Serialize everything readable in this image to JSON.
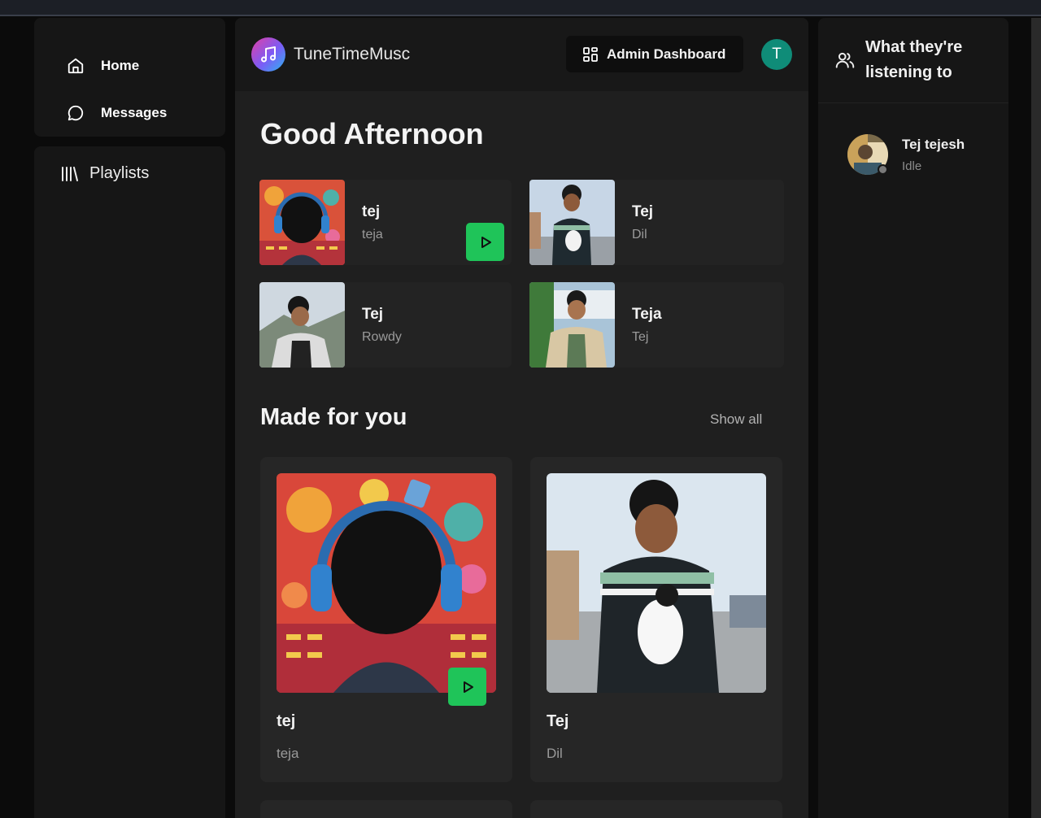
{
  "nav": {
    "home_label": "Home",
    "messages_label": "Messages",
    "playlists_label": "Playlists"
  },
  "header": {
    "brand": "TuneTimeMusc",
    "admin_label": "Admin Dashboard",
    "avatar_initial": "T"
  },
  "main": {
    "greeting": "Good Afternoon",
    "quick_picks": [
      {
        "title": "tej",
        "subtitle": "teja"
      },
      {
        "title": "Tej",
        "subtitle": "Dil"
      },
      {
        "title": "Tej",
        "subtitle": "Rowdy"
      },
      {
        "title": "Teja",
        "subtitle": "Tej"
      }
    ],
    "made_for_you": {
      "title": "Made for you",
      "show_all": "Show all",
      "cards": [
        {
          "title": "tej",
          "subtitle": "teja"
        },
        {
          "title": "Tej",
          "subtitle": "Dil"
        }
      ]
    }
  },
  "friends": {
    "title": "What they're listening to",
    "items": [
      {
        "name": "Tej tejesh",
        "status": "Idle"
      }
    ]
  },
  "colors": {
    "accent_green": "#1fc459",
    "avatar_teal": "#0f8c78",
    "panel_bg": "#161616",
    "main_bg": "#1f1f1f"
  }
}
